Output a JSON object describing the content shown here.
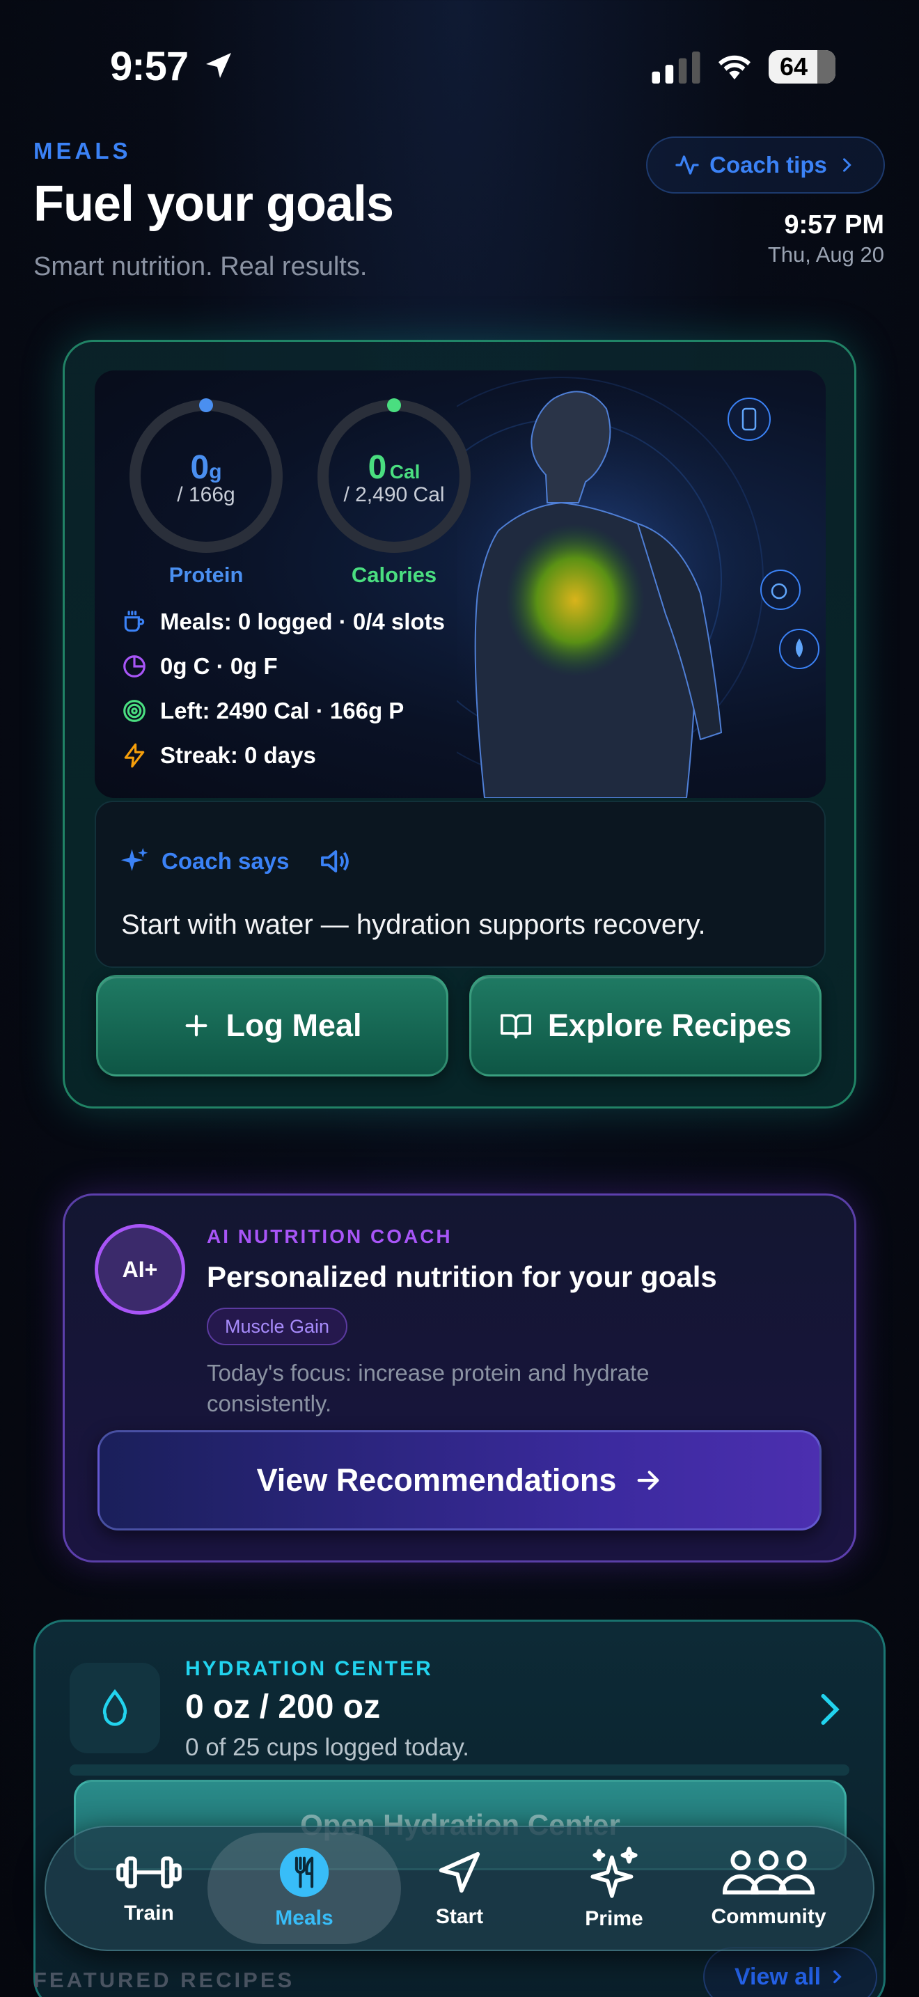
{
  "status_bar": {
    "time": "9:57",
    "battery": "64"
  },
  "header": {
    "section_label": "MEALS",
    "title": "Fuel your goals",
    "subtitle": "Smart nutrition. Real results.",
    "coach_tips_label": "Coach tips",
    "clock_time": "9:57 PM",
    "clock_date": "Thu, Aug 20"
  },
  "summary": {
    "protein": {
      "value": "0",
      "unit": "g",
      "target": "/ 166g",
      "label": "Protein",
      "progress": 0,
      "color": "#4a8ff0"
    },
    "calories": {
      "value": "0",
      "unit": "Cal",
      "target": "/ 2,490 Cal",
      "label": "Calories",
      "progress": 0,
      "color": "#4ade80"
    },
    "stats": [
      {
        "icon": "cup-icon",
        "text": "Meals: 0 logged · 0/4 slots"
      },
      {
        "icon": "pie-chart-icon",
        "text": "0g C · 0g F"
      },
      {
        "icon": "target-icon",
        "text": "Left: 2490 Cal · 166g P"
      },
      {
        "icon": "lightning-icon",
        "text": "Streak: 0 days"
      }
    ]
  },
  "coach": {
    "label": "Coach says",
    "message": "Start with water — hydration supports recovery."
  },
  "actions": {
    "log_meal": "Log Meal",
    "explore_recipes": "Explore Recipes"
  },
  "ai_coach": {
    "badge": "AI+",
    "label": "AI NUTRITION COACH",
    "title": "Personalized nutrition for your goals",
    "tag": "Muscle Gain",
    "description": "Today's focus: increase protein and hydrate consistently.",
    "button": "View Recommendations"
  },
  "hydration": {
    "label": "HYDRATION CENTER",
    "value": "0 oz / 200 oz",
    "subtitle": "0 of 25 cups logged today.",
    "progress": 0,
    "button": "Open Hydration Center"
  },
  "featured": {
    "label": "FEATURED RECIPES",
    "view_all": "View all"
  },
  "tab_bar": {
    "active": "Meals",
    "items": [
      {
        "label": "Train",
        "icon": "dumbbell-icon"
      },
      {
        "label": "Meals",
        "icon": "utensils-icon"
      },
      {
        "label": "Start",
        "icon": "navigation-arrow-icon"
      },
      {
        "label": "Prime",
        "icon": "sparkles-icon"
      },
      {
        "label": "Community",
        "icon": "users-icon"
      }
    ]
  },
  "colors": {
    "accent_blue": "#3b82f6",
    "accent_green": "#4ade80",
    "accent_purple": "#a855f7",
    "accent_cyan": "#22d3ee",
    "card_border_green": "#34d399"
  }
}
